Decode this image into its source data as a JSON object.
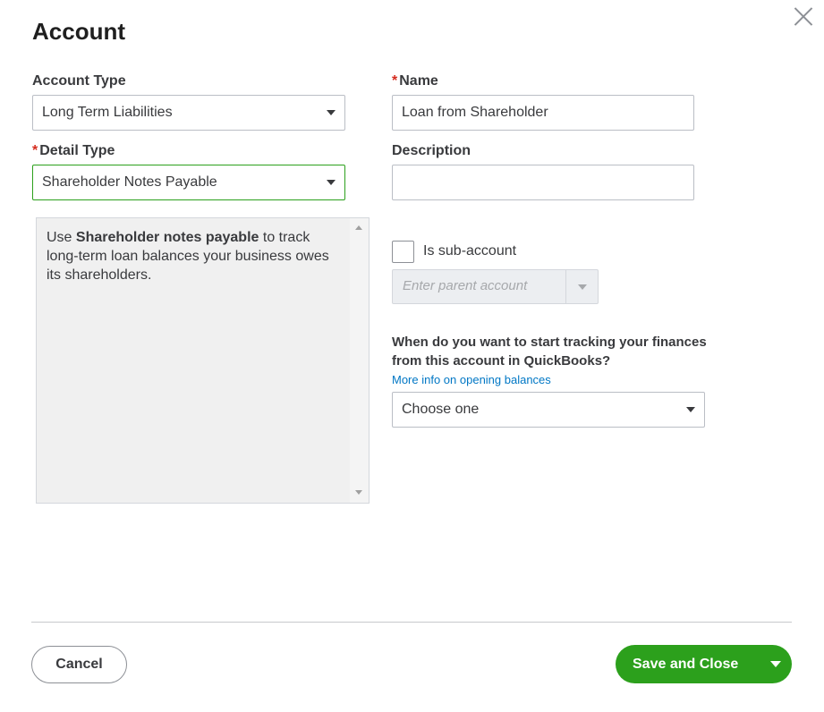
{
  "dialog": {
    "title": "Account"
  },
  "form": {
    "account_type": {
      "label": "Account Type",
      "value": "Long Term Liabilities"
    },
    "detail_type": {
      "label": "Detail Type",
      "required_mark": "*",
      "value": "Shareholder Notes Payable"
    },
    "name": {
      "label": "Name",
      "required_mark": "*",
      "value": "Loan from Shareholder"
    },
    "description": {
      "label": "Description",
      "value": ""
    },
    "detail_help": {
      "prefix": "Use ",
      "bold": "Shareholder notes payable",
      "suffix": " to track long-term loan balances your business owes its shareholders."
    },
    "sub_account": {
      "label": "Is sub-account",
      "checked": false,
      "parent_placeholder": "Enter parent account"
    },
    "opening": {
      "question": "When do you want to start tracking your finances from this account in QuickBooks?",
      "link": "More info on opening balances",
      "value": "Choose one"
    }
  },
  "footer": {
    "cancel_label": "Cancel",
    "save_label": "Save and Close"
  },
  "colors": {
    "accent_green": "#2ca01c",
    "required_red": "#d52b1e",
    "link_blue": "#0077c5"
  }
}
